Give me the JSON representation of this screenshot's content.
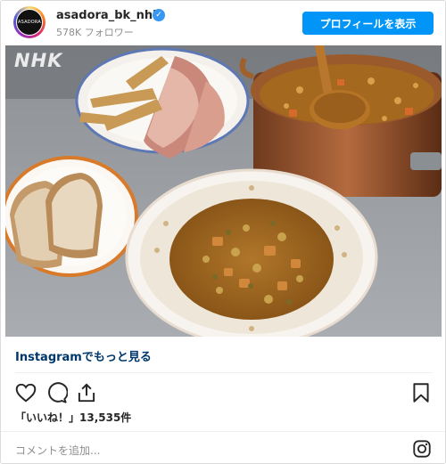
{
  "header": {
    "avatar_text": "ASADORA",
    "username": "asadora_bk_nhk",
    "verified_glyph": "✓",
    "followers": "578K フォロワー",
    "profile_button": "プロフィールを表示"
  },
  "photo": {
    "watermark": "NHK",
    "description_icon": "food-photo"
  },
  "more_link": "Instagramでもっと見る",
  "actions": {
    "like_icon": "heart-icon",
    "comment_icon": "comment-icon",
    "share_icon": "share-icon",
    "save_icon": "bookmark-icon"
  },
  "likes": "「いいね！」13,535件",
  "comment_placeholder": "コメントを追加...",
  "colors": {
    "button_blue": "#0095f6",
    "link_blue": "#00376b",
    "muted": "#8e8e8e"
  }
}
